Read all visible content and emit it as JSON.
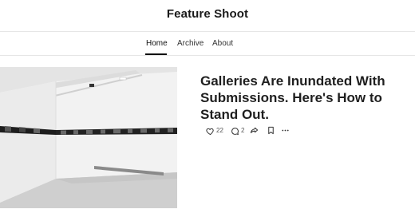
{
  "site": {
    "title": "Feature Shoot"
  },
  "nav": {
    "items": [
      {
        "label": "Home",
        "active": true
      },
      {
        "label": "Archive",
        "active": false
      },
      {
        "label": "About",
        "active": false
      }
    ]
  },
  "post": {
    "title": "Galleries Are Inundated With Submissions. Here's How to Stand Out.",
    "image_alt": "Empty white gallery room with a strip of black-and-white photographs along the walls",
    "likes": "22",
    "comments": "2",
    "icons": [
      "heart-icon",
      "comment-icon",
      "share-icon",
      "bookmark-icon",
      "more-icon"
    ]
  },
  "colors": {
    "text": "#1a1a1a",
    "divider": "#e6e6e6",
    "muted": "#555555"
  }
}
